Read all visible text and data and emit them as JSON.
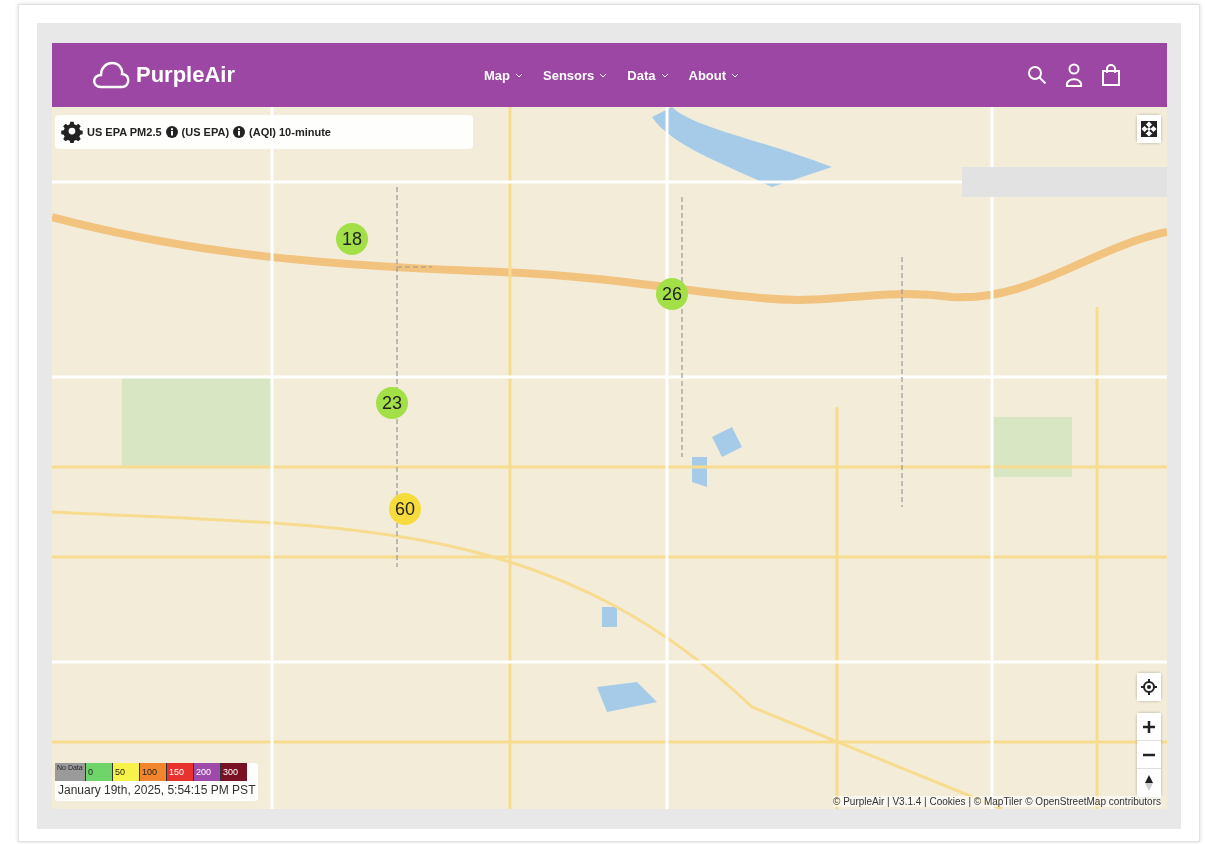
{
  "header": {
    "brand": "PurpleAir",
    "nav": [
      {
        "label": "Map"
      },
      {
        "label": "Sensors"
      },
      {
        "label": "Data"
      },
      {
        "label": "About"
      }
    ]
  },
  "map": {
    "layer_label": "US EPA PM2.5",
    "layer_parts": [
      "(US EPA)",
      "(AQI) 10-minute"
    ],
    "markers": [
      {
        "value": "18",
        "color": "#a3e048"
      },
      {
        "value": "26",
        "color": "#a3e048"
      },
      {
        "value": "23",
        "color": "#a3e048"
      },
      {
        "value": "60",
        "color": "#f5dc3c"
      }
    ],
    "legend": [
      {
        "label": "No Data",
        "color": "#9a9a9a"
      },
      {
        "label": "0",
        "color": "#6fd46a"
      },
      {
        "label": "50",
        "color": "#f7f24a"
      },
      {
        "label": "100",
        "color": "#f2862e"
      },
      {
        "label": "150",
        "color": "#e8322e"
      },
      {
        "label": "200",
        "color": "#9e4aaa"
      },
      {
        "label": "300",
        "color": "#7a1226"
      }
    ],
    "timestamp": "January 19th, 2025, 5:54:15 PM PST",
    "attribution": "© PurpleAir | V3.1.4 | Cookies | © MapTiler © OpenStreetMap contributors"
  }
}
